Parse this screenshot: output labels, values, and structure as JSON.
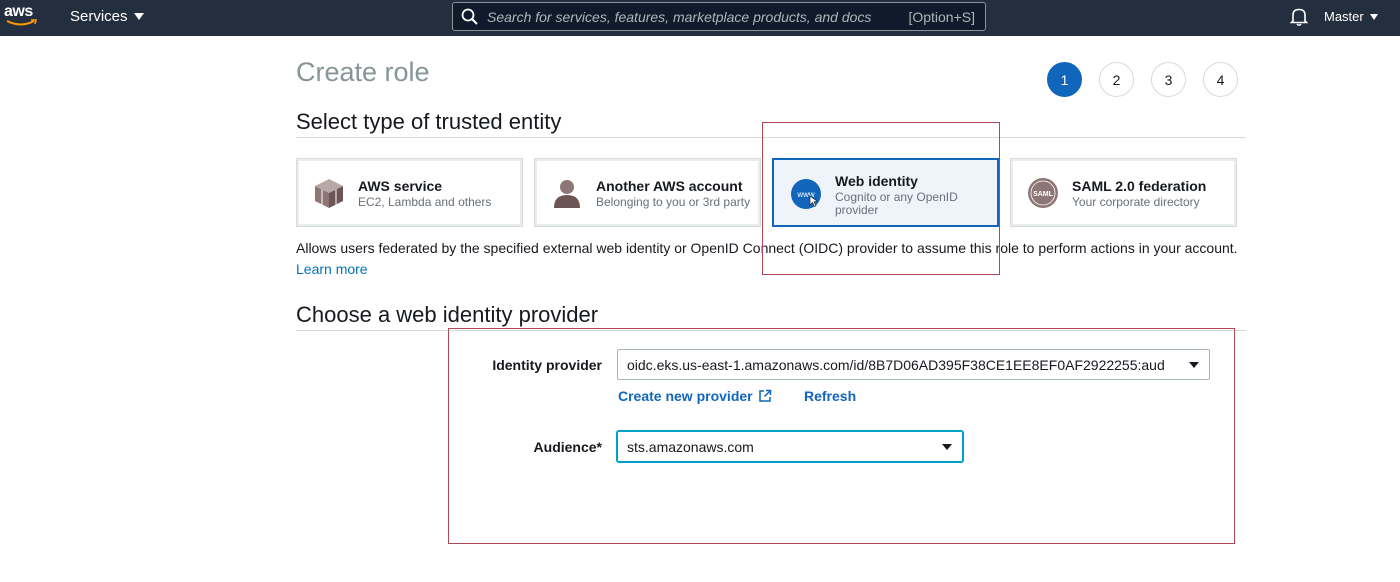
{
  "nav": {
    "logo_text": "aws",
    "services_label": "Services",
    "search_placeholder": "Search for services, features, marketplace products, and docs",
    "search_shortcut": "[Option+S]",
    "account_label": "Master"
  },
  "page": {
    "title": "Create role",
    "steps": [
      "1",
      "2",
      "3",
      "4"
    ],
    "active_step": "1"
  },
  "trusted_entity": {
    "heading": "Select type of trusted entity",
    "cards": [
      {
        "title": "AWS service",
        "subtitle": "EC2, Lambda and others",
        "icon": "cube-icon",
        "selected": false
      },
      {
        "title": "Another AWS account",
        "subtitle": "Belonging to you or 3rd party",
        "icon": "user-account-icon",
        "selected": false
      },
      {
        "title": "Web identity",
        "subtitle": "Cognito or any OpenID provider",
        "icon": "www-globe-icon",
        "selected": true
      },
      {
        "title": "SAML 2.0 federation",
        "subtitle": "Your corporate directory",
        "icon": "saml-badge-icon",
        "selected": false
      }
    ],
    "description": "Allows users federated by the specified external web identity or OpenID Connect (OIDC) provider to assume this role to perform actions in your account.",
    "learn_more": "Learn more"
  },
  "provider": {
    "heading": "Choose a web identity provider",
    "identity_provider_label": "Identity provider",
    "identity_provider_value": "oidc.eks.us-east-1.amazonaws.com/id/8B7D06AD395F38CE1EE8EF0AF2922255:aud",
    "create_new_provider": "Create new provider",
    "refresh": "Refresh",
    "audience_label": "Audience*",
    "audience_value": "sts.amazonaws.com"
  },
  "colors": {
    "nav_bg": "#232f3e",
    "primary_blue": "#1166bb",
    "link_blue": "#0073bb",
    "annotation_red": "#b0485a",
    "selected_card_bg": "#eef4fa"
  }
}
